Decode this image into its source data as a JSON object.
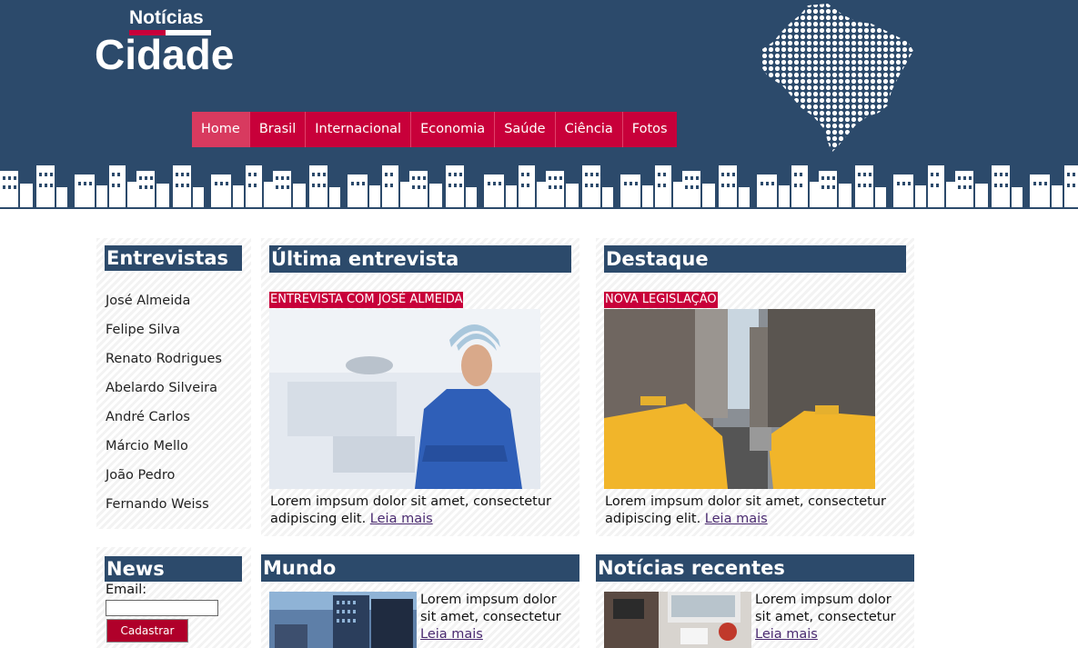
{
  "brand": {
    "top": "Notícias",
    "main": "Cidade"
  },
  "nav": {
    "items": [
      "Home",
      "Brasil",
      "Internacional",
      "Economia",
      "Saúde",
      "Ciência",
      "Fotos"
    ],
    "active": "Home"
  },
  "colors": {
    "header_bg": "#2c4a6b",
    "accent": "#c8003a",
    "heading_bg": "#2c4a6b"
  },
  "entrevistas": {
    "title": "Entrevistas",
    "names": [
      "José Almeida",
      "Felipe Silva",
      "Renato Rodrigues",
      "Abelardo Silveira",
      "André Carlos",
      "Márcio Mello",
      "João Pedro",
      "Fernando Weiss"
    ]
  },
  "ultima": {
    "title": "Última entrevista",
    "tag": "ENTREVISTA COM JOSÉ ALMEIDA",
    "text": "Lorem impsum dolor sit amet, consectetur adipiscing elit.",
    "link": "Leia mais",
    "image_icon": "doctor-photo"
  },
  "destaque": {
    "title": "Destaque",
    "tag": "NOVA LEGISLAÇÃO",
    "text": "Lorem impsum dolor sit amet, consectetur adipiscing elit.",
    "link": "Leia mais",
    "image_icon": "taxi-street-photo"
  },
  "news": {
    "title": "News",
    "email_label": "Email:",
    "email_value": "",
    "button": "Cadastrar"
  },
  "mundo": {
    "title": "Mundo",
    "text": "Lorem impsum dolor sit amet, consectetur",
    "link": "Leia mais",
    "image_icon": "city-buildings-photo"
  },
  "recentes": {
    "title": "Notícias recentes",
    "text": "Lorem impsum dolor sit amet, consectetur",
    "link": "Leia mais",
    "image_icon": "desk-items-photo"
  }
}
